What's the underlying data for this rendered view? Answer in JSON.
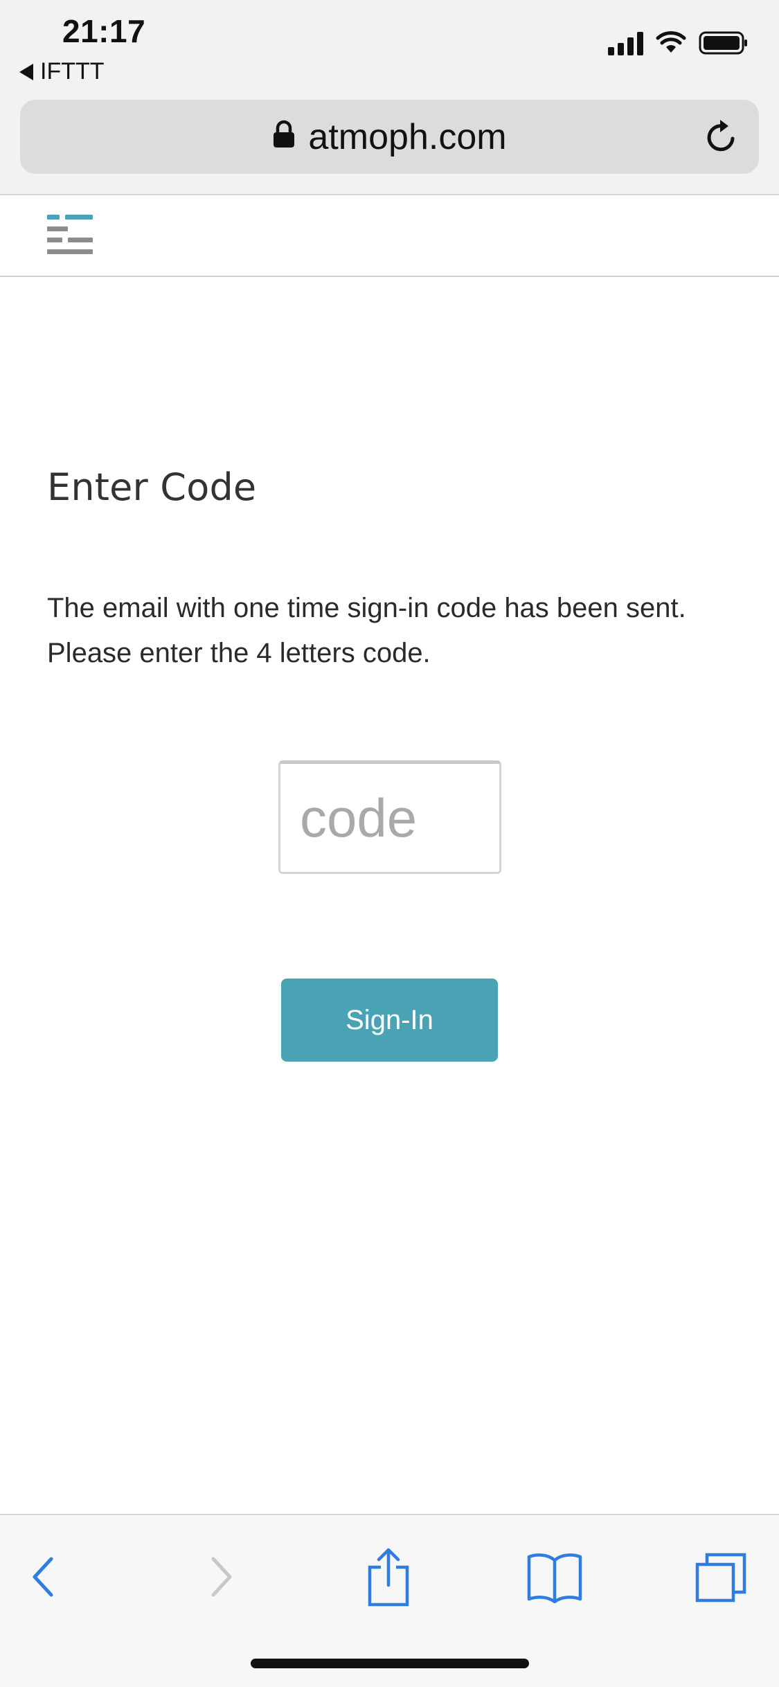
{
  "status_bar": {
    "time": "21:17",
    "back_app_label": "IFTTT"
  },
  "browser": {
    "url": "atmoph.com"
  },
  "page": {
    "heading": "Enter Code",
    "description_line1": "The email with one time sign-in code has been sent.",
    "description_line2": "Please enter the 4 letters code.",
    "code_input": {
      "placeholder": "code",
      "value": ""
    },
    "signin_label": "Sign-In"
  },
  "colors": {
    "accent": "#4aa3b5",
    "toolbar_icon": "#2f7de1",
    "toolbar_icon_disabled": "#c7c7cc"
  },
  "icons": {
    "lock": "lock-icon",
    "reload": "reload-icon",
    "menu": "menu-icon",
    "back": "chevron-left-icon",
    "forward": "chevron-right-icon",
    "share": "share-icon",
    "bookmarks": "book-icon",
    "tabs": "tabs-icon"
  }
}
